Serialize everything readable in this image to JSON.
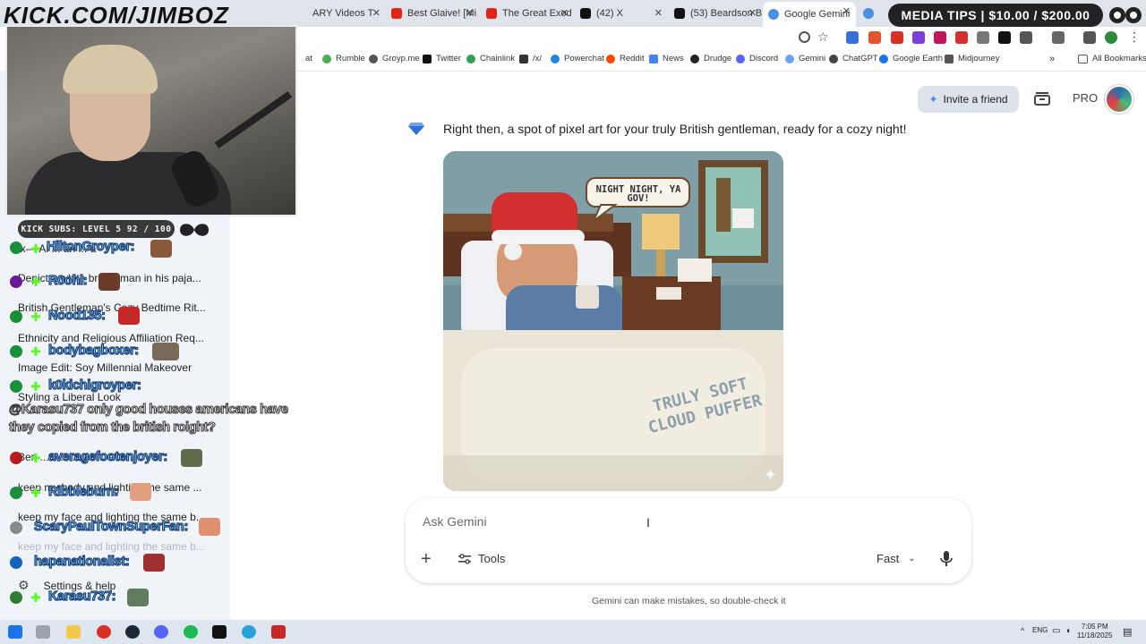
{
  "browser": {
    "tabs": [
      {
        "label": "ARY Videos T"
      },
      {
        "label": "Best Glaive! [Mi"
      },
      {
        "label": "The Great Exod"
      },
      {
        "label": "(42) X"
      },
      {
        "label": "(53) Beardson B"
      },
      {
        "label": "Google Gemini"
      }
    ],
    "bookmarks": [
      "at",
      "Rumble",
      "Groyp.me",
      "Twitter",
      "Chainlink",
      "/x/",
      "Powerchat",
      "Reddit",
      "News",
      "Drudge",
      "Discord",
      "Gemini",
      "ChatGPT",
      "Google Earth",
      "Midjourney",
      "All Bookmarks"
    ]
  },
  "overlay": {
    "channel": "KICK.COM/JIMBOZ",
    "subs": "KICK SUBS: LEVEL 5 92 / 100",
    "media_tips": "MEDIA TIPS | $10.00 / $200.00",
    "chat": {
      "names": [
        "HiltonGroyper:",
        "R0ohl:",
        "Nood135:",
        "bodybagboxer:",
        "k0kichigroyper:",
        "averagefootenjoyer:",
        "Ribbleburn:",
        "ScaryPaulTownSuperFan:",
        "hapanationalist:",
        "Karasu737:"
      ],
      "message": "@Karasu737 only good houses americans have they copied from the british roight?"
    }
  },
  "sidebar": {
    "items": [
      "ix— Ai ... an ... a",
      "Depict a white british man in his paja...",
      "British Gentleman's Cozy Bedtime Rit...",
      "Ethnicity and Religious Affiliation Req...",
      "Image Edit: Soy Millennial Makeover",
      "Styling a Liberal Look",
      "Ben ... v ... ... er ... at t...",
      "keep my body and lighting the same ...",
      "keep my face and lighting the same b...",
      "keep my face and lighting the same b..."
    ],
    "settings": "Settings & help"
  },
  "header": {
    "invite": "Invite a friend",
    "pro": "PRO"
  },
  "conversation": {
    "response": "Right then, a spot of pixel art for your truly British gentleman, ready for a cozy night!",
    "image_bubble": "NIGHT NIGHT, YA GOV!",
    "image_blanket": "TRULY SOFT CLOUD PUFFER"
  },
  "composer": {
    "placeholder": "Ask Gemini",
    "tools": "Tools",
    "mode": "Fast"
  },
  "disclaimer": "Gemini can make mistakes, so double-check it",
  "taskbar": {
    "lang": "ENG",
    "time": "7:05 PM",
    "date": "11/18/2025"
  }
}
